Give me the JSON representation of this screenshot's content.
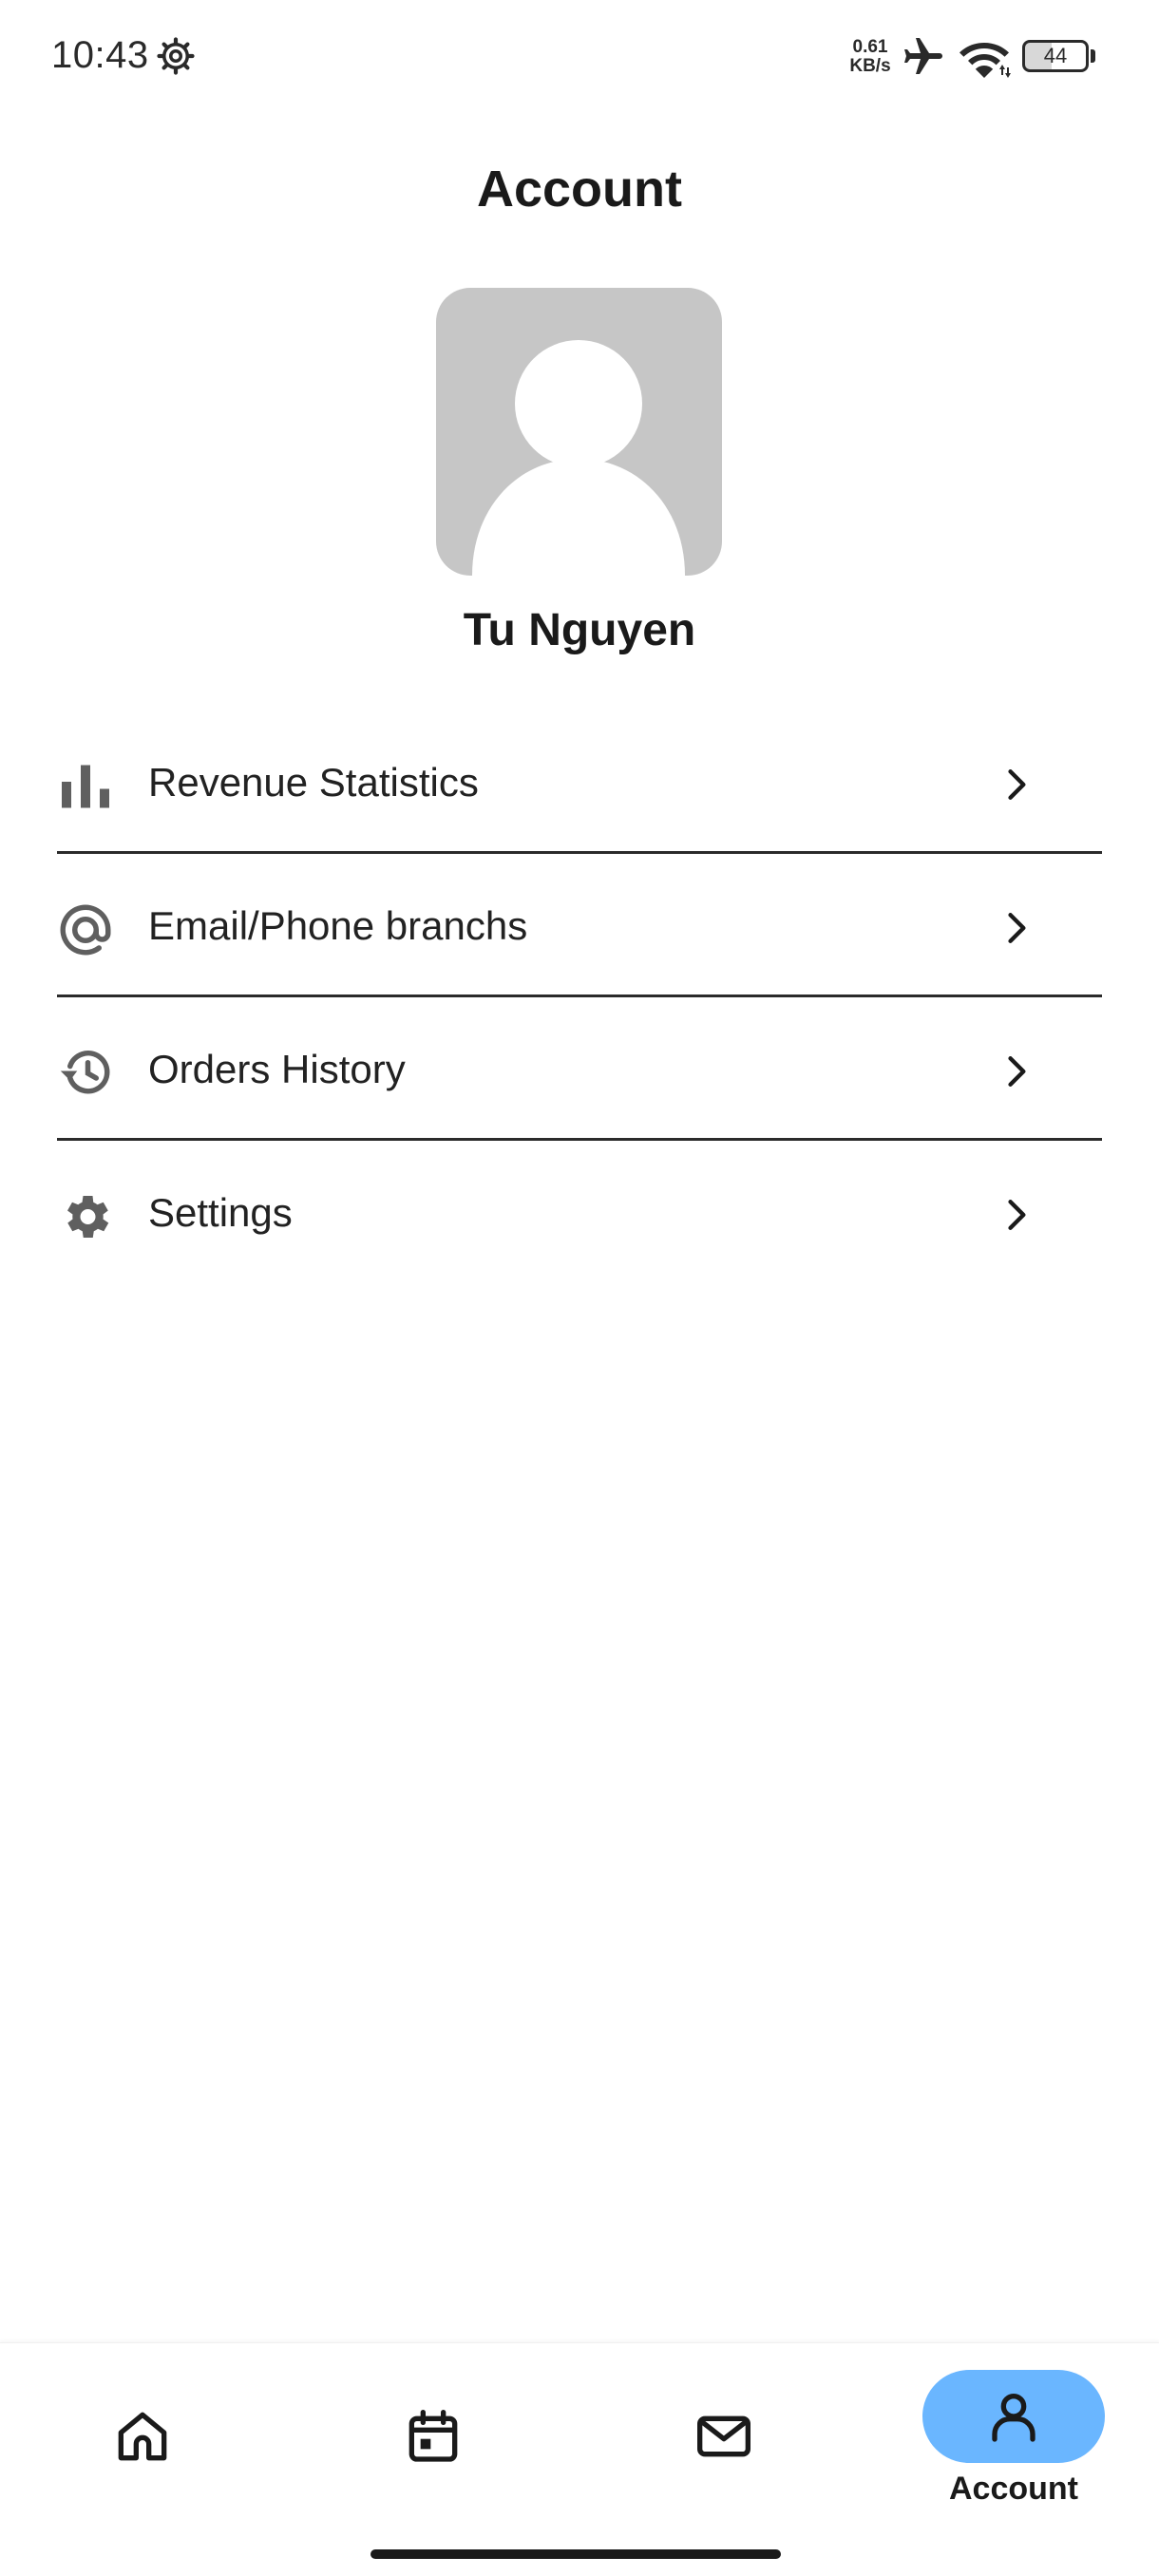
{
  "status_bar": {
    "time": "10:43",
    "net_speed_value": "0.61",
    "net_speed_unit": "KB/s",
    "battery": "44",
    "icons": [
      "gear-icon",
      "airplane-icon",
      "wifi-icon",
      "battery-icon"
    ]
  },
  "header": {
    "title": "Account"
  },
  "profile": {
    "name": "Tu Nguyen",
    "avatar_color": "#c6c6c6"
  },
  "menu": {
    "items": [
      {
        "label": "Revenue Statistics",
        "icon": "bar-chart-icon"
      },
      {
        "label": "Email/Phone branchs",
        "icon": "at-sign-icon"
      },
      {
        "label": "Orders History",
        "icon": "history-icon"
      },
      {
        "label": "Settings",
        "icon": "gear-icon"
      }
    ]
  },
  "bottom_nav": {
    "items": [
      {
        "name": "home",
        "icon": "home-icon"
      },
      {
        "name": "calendar",
        "icon": "calendar-icon"
      },
      {
        "name": "messages",
        "icon": "mail-icon"
      },
      {
        "name": "account",
        "icon": "person-icon",
        "label": "Account",
        "active": true
      }
    ],
    "active_color": "#6ab6ff"
  }
}
